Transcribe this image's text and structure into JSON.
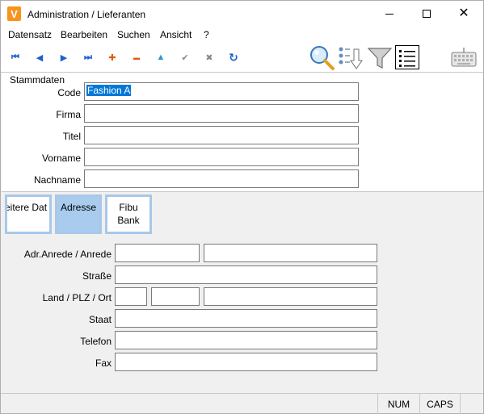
{
  "window": {
    "app_icon_letter": "V",
    "title": "Administration / Lieferanten"
  },
  "menu": {
    "items": [
      "Datensatz",
      "Bearbeiten",
      "Suchen",
      "Ansicht",
      "?"
    ]
  },
  "toolbar": {
    "first": "⏮",
    "prev": "◀",
    "next": "▶",
    "last": "⏭",
    "add": "✚",
    "remove": "▬",
    "up": "▲",
    "confirm": "✔",
    "cancel": "✖",
    "refresh": "↻"
  },
  "stammdaten": {
    "title": "Stammdaten",
    "code_label": "Code",
    "code_value": "Fashion A",
    "firma_label": "Firma",
    "firma_value": "",
    "titel_label": "Titel",
    "titel_value": "",
    "vorname_label": "Vorname",
    "vorname_value": "",
    "nachname_label": "Nachname",
    "nachname_value": ""
  },
  "tabs": [
    {
      "label": "eitere Dat"
    },
    {
      "label": "Adresse"
    },
    {
      "label_line1": "Fibu",
      "label_line2": "Bank"
    }
  ],
  "address": {
    "anrede_label": "Adr.Anrede / Anrede",
    "strasse_label": "Straße",
    "land_label": "Land / PLZ / Ort",
    "staat_label": "Staat",
    "telefon_label": "Telefon",
    "fax_label": "Fax"
  },
  "status": {
    "num": "NUM",
    "caps": "CAPS"
  },
  "colors": {
    "selection": "#0078d7",
    "tab_active": "#a8cbee",
    "tab_border": "#a8c8e8",
    "app_icon": "#f7941d"
  }
}
